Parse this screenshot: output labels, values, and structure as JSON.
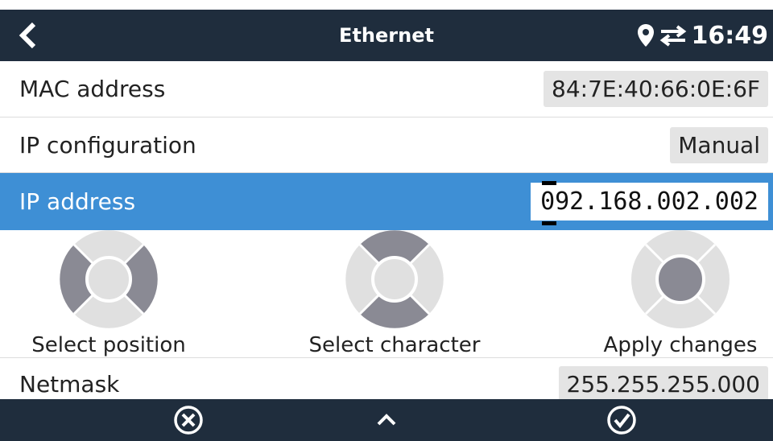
{
  "header": {
    "title": "Ethernet",
    "time": "16:49",
    "back_icon": "chevron-left-icon",
    "location_icon": "location-pin-icon",
    "transfer_icon": "swap-arrows-icon"
  },
  "rows": {
    "mac": {
      "label": "MAC address",
      "value": "84:7E:40:66:0E:6F"
    },
    "ipconfig": {
      "label": "IP configuration",
      "value": "Manual"
    },
    "ipaddr": {
      "label": "IP address",
      "value": "092.168.002.002"
    },
    "netmask": {
      "label": "Netmask",
      "value": "255.255.255.000"
    }
  },
  "help": {
    "select_position": "Select position",
    "select_character": "Select character",
    "apply_changes": "Apply changes"
  },
  "footer": {
    "cancel_icon": "cancel-icon",
    "up_icon": "chevron-up-icon",
    "confirm_icon": "checkmark-icon"
  },
  "colors": {
    "bar": "#1f2d3d",
    "highlight": "#3e8fd5",
    "pad_active": "#8a8a94",
    "pad_idle": "#e0e0e0"
  }
}
